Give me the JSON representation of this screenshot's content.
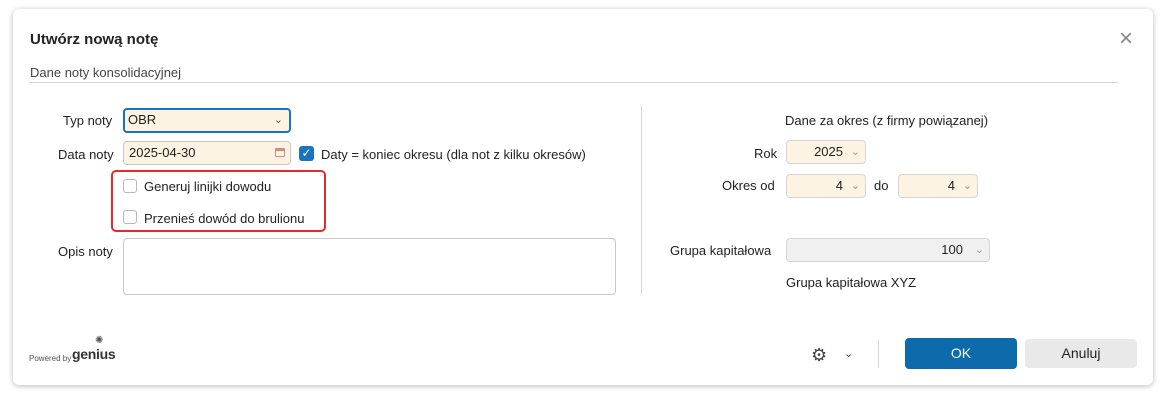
{
  "dialog": {
    "title": "Utwórz nową notę",
    "section_title": "Dane noty konsolidacyjnej"
  },
  "form": {
    "typ_noty_label": "Typ noty",
    "typ_noty_value": "OBR",
    "data_noty_label": "Data noty",
    "data_noty_value": "2025-04-30",
    "daty_checkbox_label": "Daty = koniec okresu (dla not z kilku okresów)",
    "daty_checkbox_checked": true,
    "generuj_label": "Generuj linijki dowodu",
    "generuj_checked": false,
    "przenies_label": "Przenieś dowód do brulionu",
    "przenies_checked": false,
    "opis_label": "Opis noty",
    "opis_value": ""
  },
  "period": {
    "heading": "Dane za okres  (z firmy powiązanej)",
    "rok_label": "Rok",
    "rok_value": "2025",
    "okres_od_label": "Okres od",
    "okres_od_value": "4",
    "do_label": "do",
    "okres_do_value": "4",
    "grupa_label": "Grupa kapitałowa",
    "grupa_value": "100",
    "grupa_name": "Grupa kapitałowa XYZ"
  },
  "footer": {
    "powered_by": "Powered by",
    "brand": "genius",
    "ok_label": "OK",
    "cancel_label": "Anuluj"
  },
  "colors": {
    "primary": "#0d6aab",
    "field_bg": "#fdf3e3",
    "highlight_border": "#e32b2b"
  }
}
